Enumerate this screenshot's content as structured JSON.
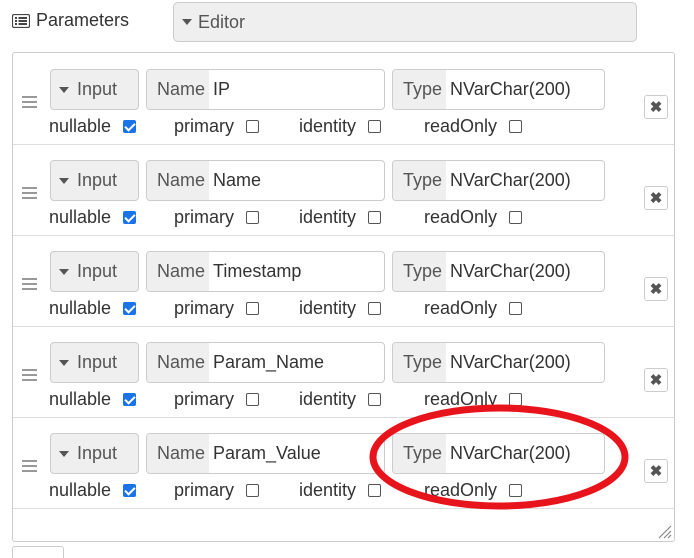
{
  "header": {
    "parameters_label": "Parameters",
    "editor_select": "Editor"
  },
  "rows": [
    {
      "direction": "Input",
      "name_label": "Name",
      "name": "IP",
      "type_label": "Type",
      "type": "NVarChar(200)",
      "flags": {
        "nullable": {
          "label": "nullable",
          "checked": true
        },
        "primary": {
          "label": "primary",
          "checked": false
        },
        "identity": {
          "label": "identity",
          "checked": false
        },
        "readOnly": {
          "label": "readOnly",
          "checked": false
        }
      }
    },
    {
      "direction": "Input",
      "name_label": "Name",
      "name": "Name",
      "type_label": "Type",
      "type": "NVarChar(200)",
      "flags": {
        "nullable": {
          "label": "nullable",
          "checked": true
        },
        "primary": {
          "label": "primary",
          "checked": false
        },
        "identity": {
          "label": "identity",
          "checked": false
        },
        "readOnly": {
          "label": "readOnly",
          "checked": false
        }
      }
    },
    {
      "direction": "Input",
      "name_label": "Name",
      "name": "Timestamp",
      "type_label": "Type",
      "type": "NVarChar(200)",
      "flags": {
        "nullable": {
          "label": "nullable",
          "checked": true
        },
        "primary": {
          "label": "primary",
          "checked": false
        },
        "identity": {
          "label": "identity",
          "checked": false
        },
        "readOnly": {
          "label": "readOnly",
          "checked": false
        }
      }
    },
    {
      "direction": "Input",
      "name_label": "Name",
      "name": "Param_Name",
      "type_label": "Type",
      "type": "NVarChar(200)",
      "flags": {
        "nullable": {
          "label": "nullable",
          "checked": true
        },
        "primary": {
          "label": "primary",
          "checked": false
        },
        "identity": {
          "label": "identity",
          "checked": false
        },
        "readOnly": {
          "label": "readOnly",
          "checked": false
        }
      }
    },
    {
      "direction": "Input",
      "name_label": "Name",
      "name": "Param_Value",
      "type_label": "Type",
      "type": "NVarChar(200)",
      "flags": {
        "nullable": {
          "label": "nullable",
          "checked": true
        },
        "primary": {
          "label": "primary",
          "checked": false
        },
        "identity": {
          "label": "identity",
          "checked": false
        },
        "readOnly": {
          "label": "readOnly",
          "checked": false
        }
      }
    }
  ],
  "icons": {
    "parameters": "list-icon",
    "dropdown": "caret-down-icon",
    "drag": "drag-handle-icon",
    "remove": "close-icon",
    "resize": "resize-grip-icon"
  },
  "colors": {
    "checkbox_checked": "#1a73e8",
    "annotation_circle": "#e8141c",
    "addon_bg": "#efefef",
    "border": "#cccccc"
  }
}
